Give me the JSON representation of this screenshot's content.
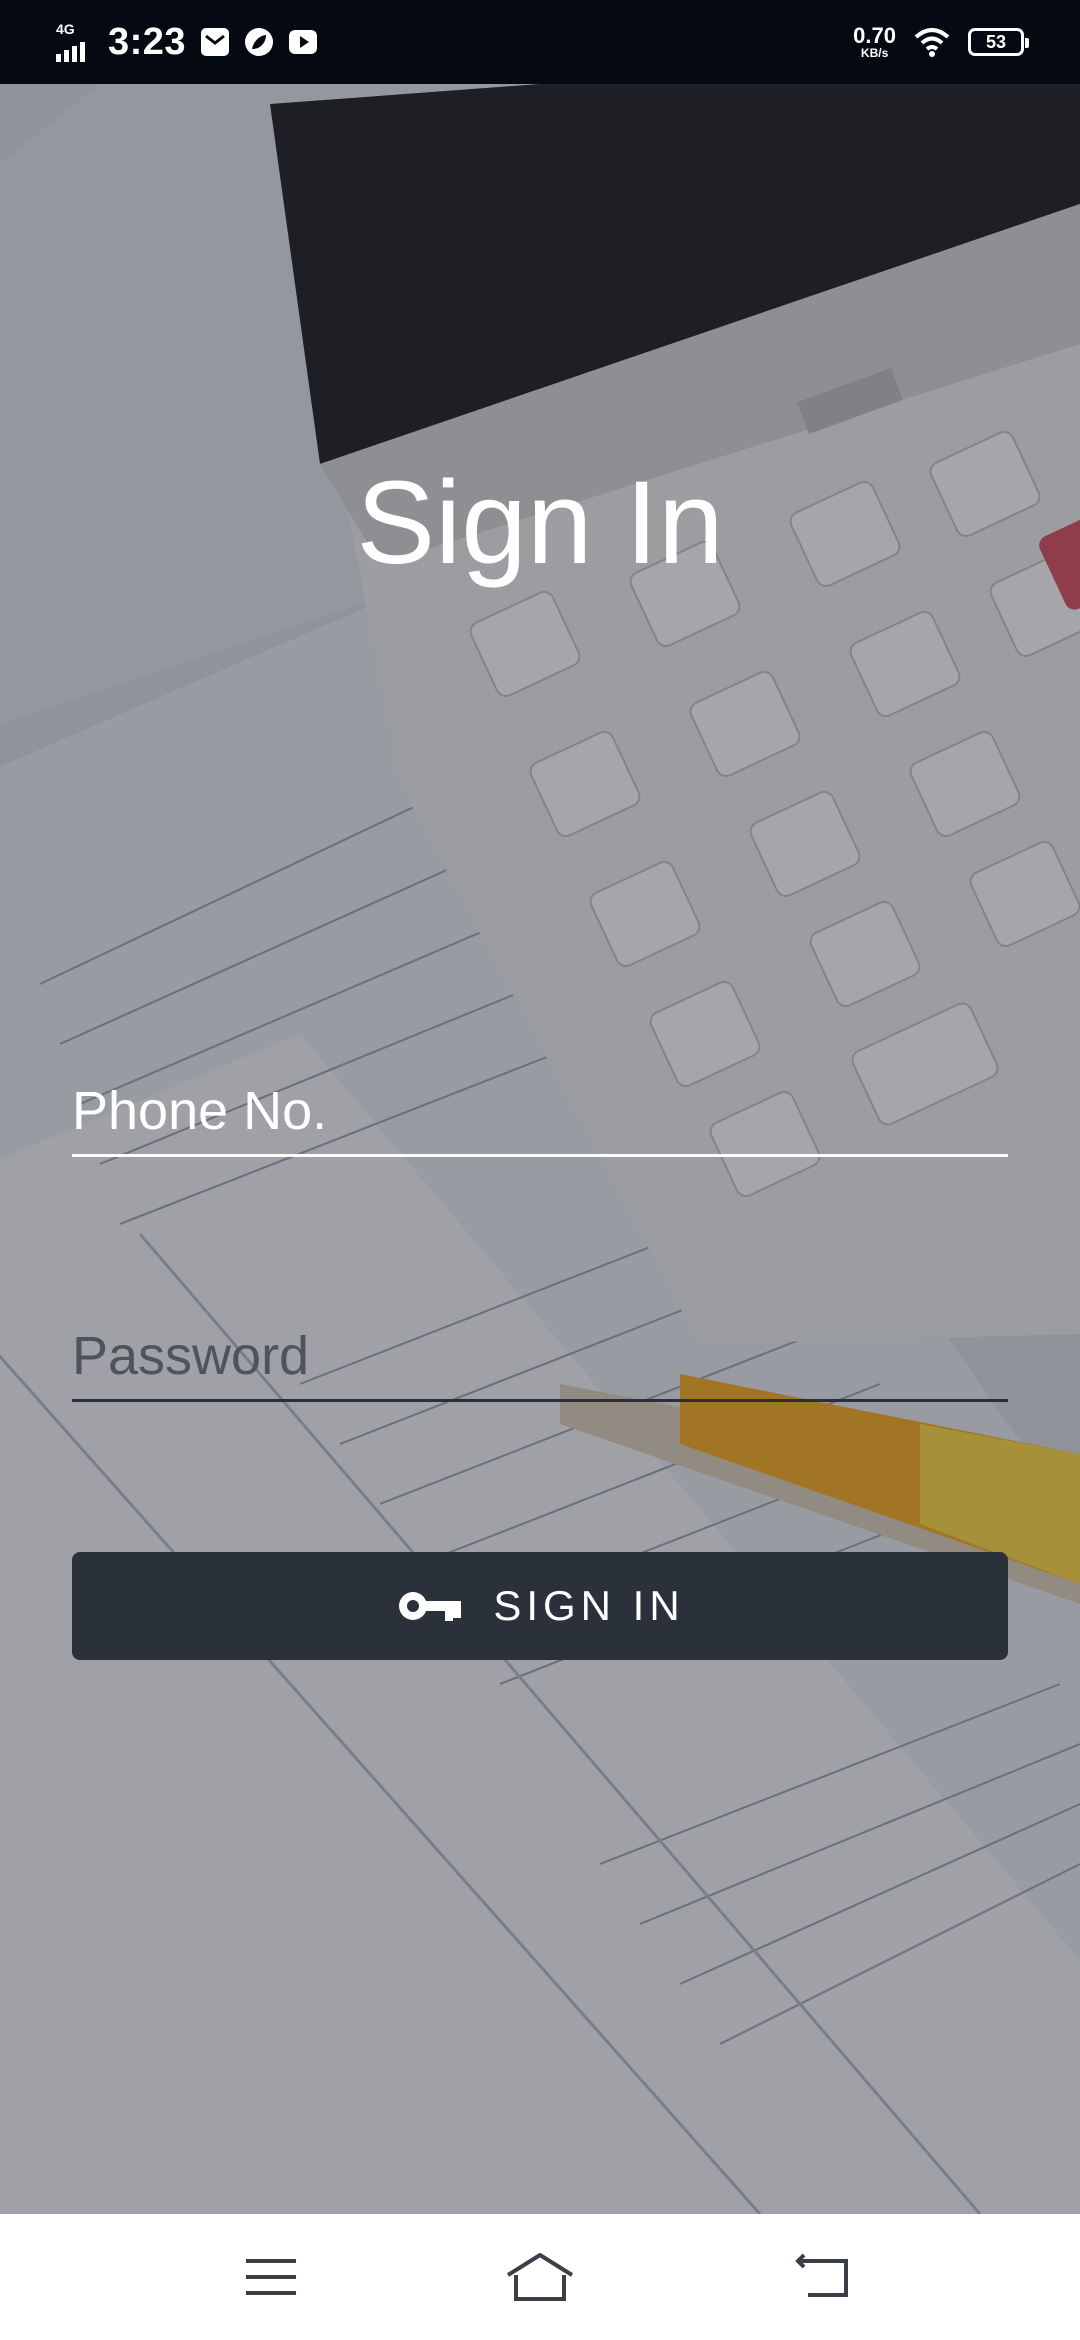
{
  "status_bar": {
    "network": "4G",
    "time": "3:23",
    "speed_value": "0.70",
    "speed_unit": "KB/s",
    "battery": "53"
  },
  "page": {
    "title": "Sign In"
  },
  "form": {
    "phone_placeholder": "Phone No.",
    "password_placeholder": "Password",
    "submit_label": "SIGN IN",
    "submit_icon": "key-icon"
  },
  "nav_bar": {
    "items": [
      "menu-icon",
      "home-icon",
      "back-icon"
    ]
  },
  "colors": {
    "status_bar_bg": "#050a12",
    "button_bg": "#2a313b",
    "text_light": "#ffffff",
    "nav_icon": "#3a3f47"
  }
}
